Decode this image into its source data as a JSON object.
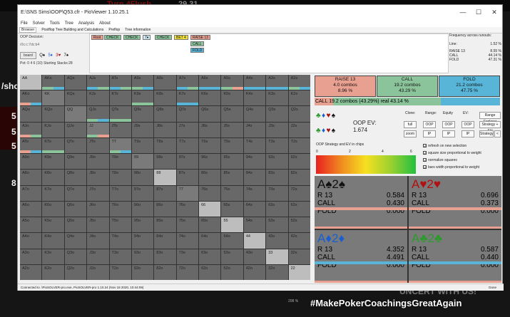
{
  "background": {
    "top_text": "Turn 4Flush",
    "top_num": "29 31",
    "left_labels": [
      "/sho",
      "5",
      "5",
      "5",
      "8"
    ],
    "bottom_caption": "#MakePokerCoachingsGreatAgain",
    "bottom_caption2": "UNCERT WITH US!"
  },
  "window": {
    "title": "E:\\SNS Sims\\OOP\\Q53.cfr - PioViewer 1.10.25.1",
    "controls": [
      "—",
      "☐",
      "✕"
    ],
    "menu": [
      "File",
      "Solver",
      "Tools",
      "Tree",
      "Analysis",
      "About"
    ],
    "tabs": [
      "Browser",
      "Postflop Tree Building and Calculations",
      "Preflop",
      "Tree information"
    ],
    "active_tab": 0
  },
  "left_info": {
    "decision_label": "OOP Decision:",
    "board": "r0c:c:7dc:b4",
    "board_button": "board",
    "suit_icons": [
      "Q♠",
      "5♦",
      "3♥",
      "7♠"
    ],
    "pot_line": "Pot: 0 4 6 (10) Starting Stacks:28"
  },
  "tree": {
    "row1": [
      {
        "label": "Root",
        "color": "#e8a090"
      },
      {
        "label": "CHECK",
        "color": "#8bc49a"
      },
      {
        "label": "CHECK",
        "color": "#8bc49a"
      },
      {
        "label": "7♦",
        "color": "#cfe7f6"
      },
      {
        "label": "CHECK",
        "color": "#8bc49a"
      },
      {
        "label": "BET 4",
        "color": "#f2e23a"
      },
      {
        "label": "RAISE 13",
        "color": "#e8a090"
      }
    ],
    "row2": [
      {
        "label": "CALL",
        "color": "#8bc49a"
      }
    ],
    "row3": [
      {
        "label": "FOLD",
        "color": "#58b5d8"
      }
    ]
  },
  "frequency": {
    "title": "Frequency across runouts:",
    "line_label": "Line:",
    "line_value": "1.52 %",
    "rows": [
      {
        "label": "RAISE 13",
        "value": "8.55 %"
      },
      {
        "label": "CALL",
        "value": "44.14 %"
      },
      {
        "label": "FOLD",
        "value": "47.31 %"
      }
    ]
  },
  "grid": {
    "labels": [
      [
        "AA",
        "AKs",
        "AQs",
        "AJs",
        "ATs",
        "A9s",
        "A8s",
        "A7s",
        "A6s",
        "A5s",
        "A4s",
        "A3s",
        "A2s"
      ],
      [
        "AKo",
        "KK",
        "KQs",
        "KJs",
        "KTs",
        "K9s",
        "K8s",
        "K7s",
        "K6s",
        "K5s",
        "K4s",
        "K3s",
        "K2s"
      ],
      [
        "AQo",
        "KQo",
        "QQ",
        "QJs",
        "QTs",
        "Q9s",
        "Q8s",
        "Q7s",
        "Q6s",
        "Q5s",
        "Q4s",
        "Q3s",
        "Q2s"
      ],
      [
        "AJo",
        "KJo",
        "QJo",
        "JJ",
        "JTs",
        "J9s",
        "J8s",
        "J7s",
        "J6s",
        "J5s",
        "J4s",
        "J3s",
        "J2s"
      ],
      [
        "ATo",
        "KTo",
        "QTo",
        "JTo",
        "TT",
        "T9s",
        "T8s",
        "T7s",
        "T6s",
        "T5s",
        "T4s",
        "T3s",
        "T2s"
      ],
      [
        "A9o",
        "K9o",
        "Q9o",
        "J9o",
        "T9o",
        "99",
        "98s",
        "97s",
        "96s",
        "95s",
        "94s",
        "93s",
        "92s"
      ],
      [
        "A8o",
        "K8o",
        "Q8o",
        "J8o",
        "T8o",
        "98o",
        "88",
        "87s",
        "86s",
        "85s",
        "84s",
        "83s",
        "82s"
      ],
      [
        "A7o",
        "K7o",
        "Q7o",
        "J7o",
        "T7o",
        "97o",
        "87o",
        "77",
        "76s",
        "75s",
        "74s",
        "73s",
        "72s"
      ],
      [
        "A6o",
        "K6o",
        "Q6o",
        "J6o",
        "T6o",
        "96o",
        "86o",
        "76o",
        "66",
        "65s",
        "64s",
        "63s",
        "62s"
      ],
      [
        "A5o",
        "K5o",
        "Q5o",
        "J5o",
        "T5o",
        "95o",
        "85o",
        "75o",
        "65o",
        "55",
        "54s",
        "53s",
        "52s"
      ],
      [
        "A4o",
        "K4o",
        "Q4o",
        "J4o",
        "T4o",
        "94o",
        "84o",
        "74o",
        "64o",
        "54o",
        "44",
        "43s",
        "42s"
      ],
      [
        "A3o",
        "K3o",
        "Q3o",
        "J3o",
        "T3o",
        "93o",
        "83o",
        "73o",
        "63o",
        "53o",
        "43o",
        "33",
        "32s"
      ],
      [
        "A2o",
        "K2o",
        "Q2o",
        "J2o",
        "T2o",
        "92o",
        "82o",
        "72o",
        "62o",
        "52o",
        "42o",
        "32o",
        "22"
      ]
    ]
  },
  "actions": [
    {
      "name": "RAISE 13",
      "combos": "4.0 combos",
      "pct": "8.96 %",
      "color": "#e8a090"
    },
    {
      "name": "CALL",
      "combos": "19.2 combos",
      "pct": "43.29 %",
      "color": "#8bc49a"
    },
    {
      "name": "FOLD",
      "combos": "21.2 combos",
      "pct": "47.75 %",
      "color": "#58b5d8"
    }
  ],
  "call_line": "CALL   19.2 combos (43.29%) real  43.14 %",
  "mid": {
    "suits": [
      "♣",
      "♦",
      "♥",
      "♠"
    ],
    "oop_ev_label": "OOP EV:",
    "oop_ev_value": "1.674",
    "col_headers": [
      "Clone:",
      "Range:",
      "Equity",
      "EV:"
    ],
    "buttons_row1": [
      "full",
      "OOP",
      "OOP",
      "OOP"
    ],
    "buttons_row2": [
      "zoom",
      "IP",
      "IP",
      "IP"
    ],
    "range_explorer": "Range Explorer",
    "strategy_ev": "Strategy + EV",
    "strategy": "Strategy",
    "strategy_arrow": "<",
    "strategy_label": "OOP Strategy and EV in chips",
    "scale": [
      "0",
      "2",
      "4",
      "6"
    ],
    "checks": [
      "refresh on new selection",
      "square size proportional to weight",
      "normalize squares",
      "bars width proportional to weight"
    ]
  },
  "combos": [
    {
      "name": "A♠2♠",
      "color": "#111111",
      "rows": [
        [
          "R 13",
          "0.584"
        ],
        [
          "CALL",
          "0.430"
        ],
        [
          "FOLD",
          "0.000"
        ]
      ],
      "stripe": "#e8a090"
    },
    {
      "name": "A♥2♥",
      "color": "#b01010",
      "rows": [
        [
          "R 13",
          "0.696"
        ],
        [
          "CALL",
          "0.373"
        ],
        [
          "FOLD",
          "0.000"
        ]
      ],
      "stripe": "#e8a090"
    },
    {
      "name": "A♦2♦",
      "color": "#1a5fd0",
      "rows": [
        [
          "R 13",
          "4.352"
        ],
        [
          "CALL",
          "4.491"
        ],
        [
          "FOLD",
          "0.000"
        ]
      ],
      "stripe": "#58b5d8"
    },
    {
      "name": "A♣2♣",
      "color": "#2e9a2e",
      "rows": [
        [
          "R 13",
          "0.587"
        ],
        [
          "CALL",
          "0.440"
        ],
        [
          "FOLD",
          "0.000"
        ]
      ],
      "stripe": "#58b5d8"
    }
  ],
  "status": {
    "text": "Connected to .\\PioSOLVER-pro.exe, PioSOLVER-pro 1.10.24 (Nov 18 2020, 10:44:09)",
    "done": "Done"
  },
  "zoom": "208 %"
}
